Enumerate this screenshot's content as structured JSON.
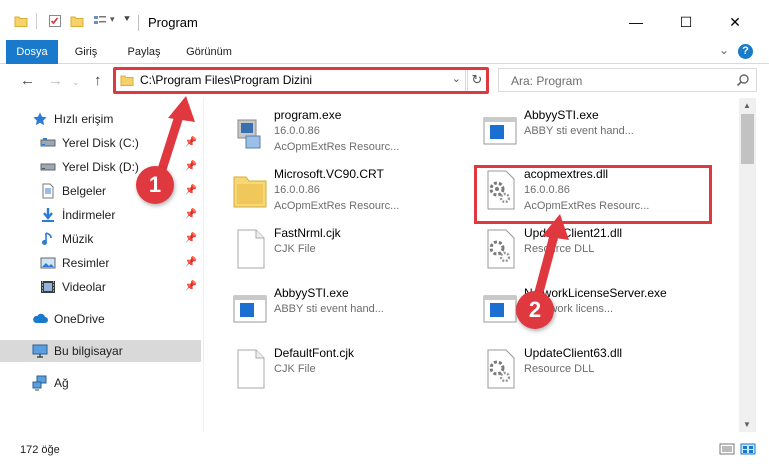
{
  "window": {
    "title": "Program",
    "minimize": "—",
    "maximize": "☐",
    "close": "✕"
  },
  "ribbon": {
    "tabs": [
      "Dosya",
      "Giriş",
      "Paylaş",
      "Görünüm"
    ],
    "help": "?"
  },
  "navigation": {
    "back": "←",
    "forward": "→",
    "up": "↑",
    "address": "C:\\Program Files\\Program Dizini",
    "search_placeholder": "Ara: Program"
  },
  "sidebar": {
    "items": [
      {
        "label": "Hızlı erişim",
        "icon": "star-icon",
        "pinned": false
      },
      {
        "label": "Yerel Disk (C:)",
        "icon": "drive-icon",
        "pinned": true
      },
      {
        "label": "Yerel Disk (D:)",
        "icon": "drive-icon",
        "pinned": true
      },
      {
        "label": "Belgeler",
        "icon": "documents-icon",
        "pinned": true
      },
      {
        "label": "İndirmeler",
        "icon": "download-icon",
        "pinned": true
      },
      {
        "label": "Müzik",
        "icon": "music-icon",
        "pinned": true
      },
      {
        "label": "Resimler",
        "icon": "pictures-icon",
        "pinned": true
      },
      {
        "label": "Videolar",
        "icon": "videos-icon",
        "pinned": true
      },
      {
        "label": "OneDrive",
        "icon": "cloud-icon",
        "pinned": false
      },
      {
        "label": "Bu bilgisayar",
        "icon": "computer-icon",
        "pinned": false
      },
      {
        "label": "Ağ",
        "icon": "network-icon",
        "pinned": false
      }
    ]
  },
  "files": [
    {
      "name": "program.exe",
      "line2": "16.0.0.86",
      "line3": "AcOpmExtRes Resourc...",
      "icon": "exe-icon"
    },
    {
      "name": "AbbyySTI.exe",
      "line2": "ABBY sti event hand...",
      "line3": "",
      "icon": "app-window-icon"
    },
    {
      "name": "Microsoft.VC90.CRT",
      "line2": "16.0.0.86",
      "line3": "AcOpmExtRes Resourc...",
      "icon": "folder-icon"
    },
    {
      "name": "acopmextres.dll",
      "line2": "16.0.0.86",
      "line3": "AcOpmExtRes Resourc...",
      "icon": "dll-gear-icon"
    },
    {
      "name": "FastNrml.cjk",
      "line2": "CJK File",
      "line3": "",
      "icon": "blank-file-icon"
    },
    {
      "name": "UpdateClient21.dll",
      "line2": "Resource DLL",
      "line3": "",
      "icon": "dll-gear-icon"
    },
    {
      "name": "AbbyySTI.exe",
      "line2": "ABBY sti event hand...",
      "line3": "",
      "icon": "app-window-icon"
    },
    {
      "name": "NetworkLicenseServer.exe",
      "line2": "Y network licens...",
      "line3": "",
      "icon": "app-window-icon"
    },
    {
      "name": "DefaultFont.cjk",
      "line2": "CJK File",
      "line3": "",
      "icon": "blank-file-icon"
    },
    {
      "name": "UpdateClient63.dll",
      "line2": "Resource DLL",
      "line3": "",
      "icon": "dll-gear-icon"
    }
  ],
  "status": {
    "count": "172 öğe"
  },
  "annotations": {
    "badge1": "1",
    "badge2": "2",
    "highlight_color": "#e0383f"
  },
  "colors": {
    "accent": "#1979ca",
    "selection": "#cce8ff"
  }
}
